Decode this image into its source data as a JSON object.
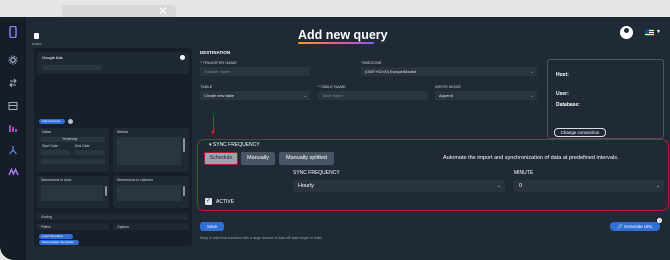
{
  "browser": {
    "tab_close": "✕"
  },
  "header": {
    "title": "Add new query",
    "logo_text": "DWBIX"
  },
  "left_panel": {
    "source_name": "Google Ads",
    "add_button": "Add Accounts",
    "section_dates": "Dates",
    "section_metrics": "Metrics",
    "yesterday": "Yesterday",
    "start_date": "Start Date",
    "end_date": "End Date",
    "dimensions_rows": "Dimensions in rows",
    "dimensions_columns": "Dimensions in columns",
    "sorting": "Sorting",
    "filters": "Filters",
    "options": "Options",
    "load_templates": "Load Templates",
    "save_templates": "Save/Update Templates"
  },
  "destination": {
    "section_title": "DESTINATION",
    "transfer_name_label": "* TRANSFER NAME",
    "transfer_name_placeholder": "Transfer Name",
    "timezone_label": "TIMEZONE",
    "timezone_value": "(GMT+02:00) Europe/Madrid",
    "table_label": "TABLE",
    "table_value": "Create new table",
    "table_name_label": "* TABLE NAME",
    "table_name_placeholder": "Table Name",
    "write_mode_label": "WRITE MODE",
    "write_mode_value": "Append"
  },
  "info_panel": {
    "host_label": "Host:",
    "user_label": "User:",
    "database_label": "Database:",
    "change_connection": "Change connection"
  },
  "sync": {
    "title": "SYNC FREQUENCY",
    "tabs": [
      "Schedule",
      "Manually",
      "Manually splitted"
    ],
    "active_tab": "Schedule",
    "description": "Automate the import and synchronization of data at predefined intervals.",
    "frequency_label": "SYNC FREQUENCY",
    "frequency_value": "Hourly",
    "minute_label": "MINUTE",
    "minute_value": "0",
    "active_label": "ACTIVE",
    "active_checked": true
  },
  "footer": {
    "save": "Save",
    "generate_url": "Generate URL",
    "note": "Keep in mind that transfers with a large amount of data will take longer to finish"
  },
  "colors": {
    "accent": "#2f6fd6",
    "highlight": "#b01e2e",
    "background": "#202a36"
  }
}
